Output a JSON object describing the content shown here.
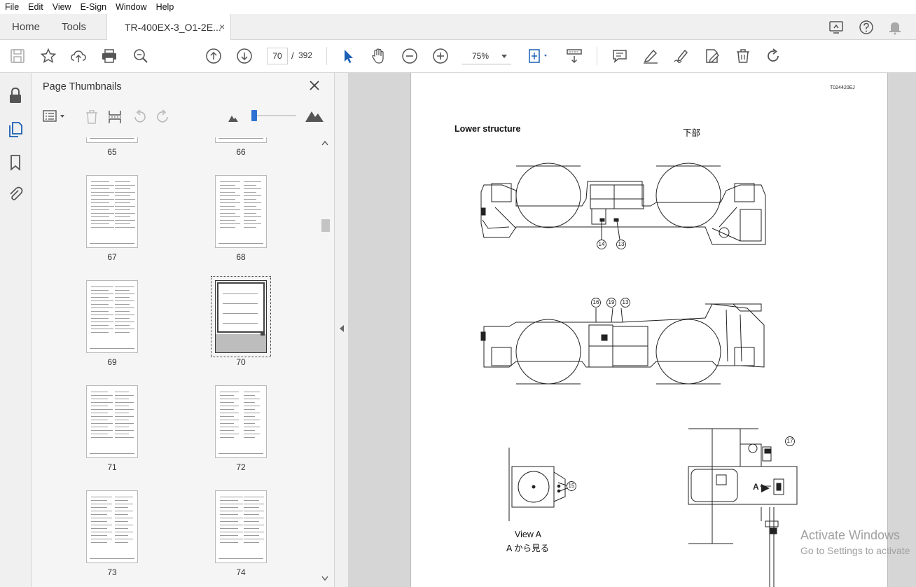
{
  "menu": [
    "File",
    "Edit",
    "View",
    "E-Sign",
    "Window",
    "Help"
  ],
  "tabs": {
    "home": "Home",
    "tools": "Tools",
    "document": "TR-400EX-3_O1-2E...",
    "close": "×"
  },
  "toolbar": {
    "current_page": "70",
    "separator": "/",
    "total_pages": "392",
    "zoom": "75%"
  },
  "panel": {
    "title": "Page Thumbnails",
    "zoom_level": 0.0
  },
  "thumbnails": [
    {
      "label": "65"
    },
    {
      "label": "66"
    },
    {
      "label": "67"
    },
    {
      "label": "68"
    },
    {
      "label": "69"
    },
    {
      "label": "70"
    },
    {
      "label": "71"
    },
    {
      "label": "72"
    },
    {
      "label": "73"
    },
    {
      "label": "74"
    }
  ],
  "document": {
    "code": "T024420EJ",
    "title": "Lower structure",
    "title_jp": "下部",
    "callouts": [
      "14",
      "13",
      "16",
      "19",
      "13",
      "15",
      "17"
    ],
    "label_a": "A",
    "view_a": "View A",
    "view_a_jp": "A から見る"
  },
  "watermark": {
    "line1": "Activate Windows",
    "line2": "Go to Settings to activate"
  },
  "colors": {
    "accent": "#2d72d2",
    "toolbar_bg": "#f0f0f0",
    "doc_bg": "#d6d6d6"
  }
}
